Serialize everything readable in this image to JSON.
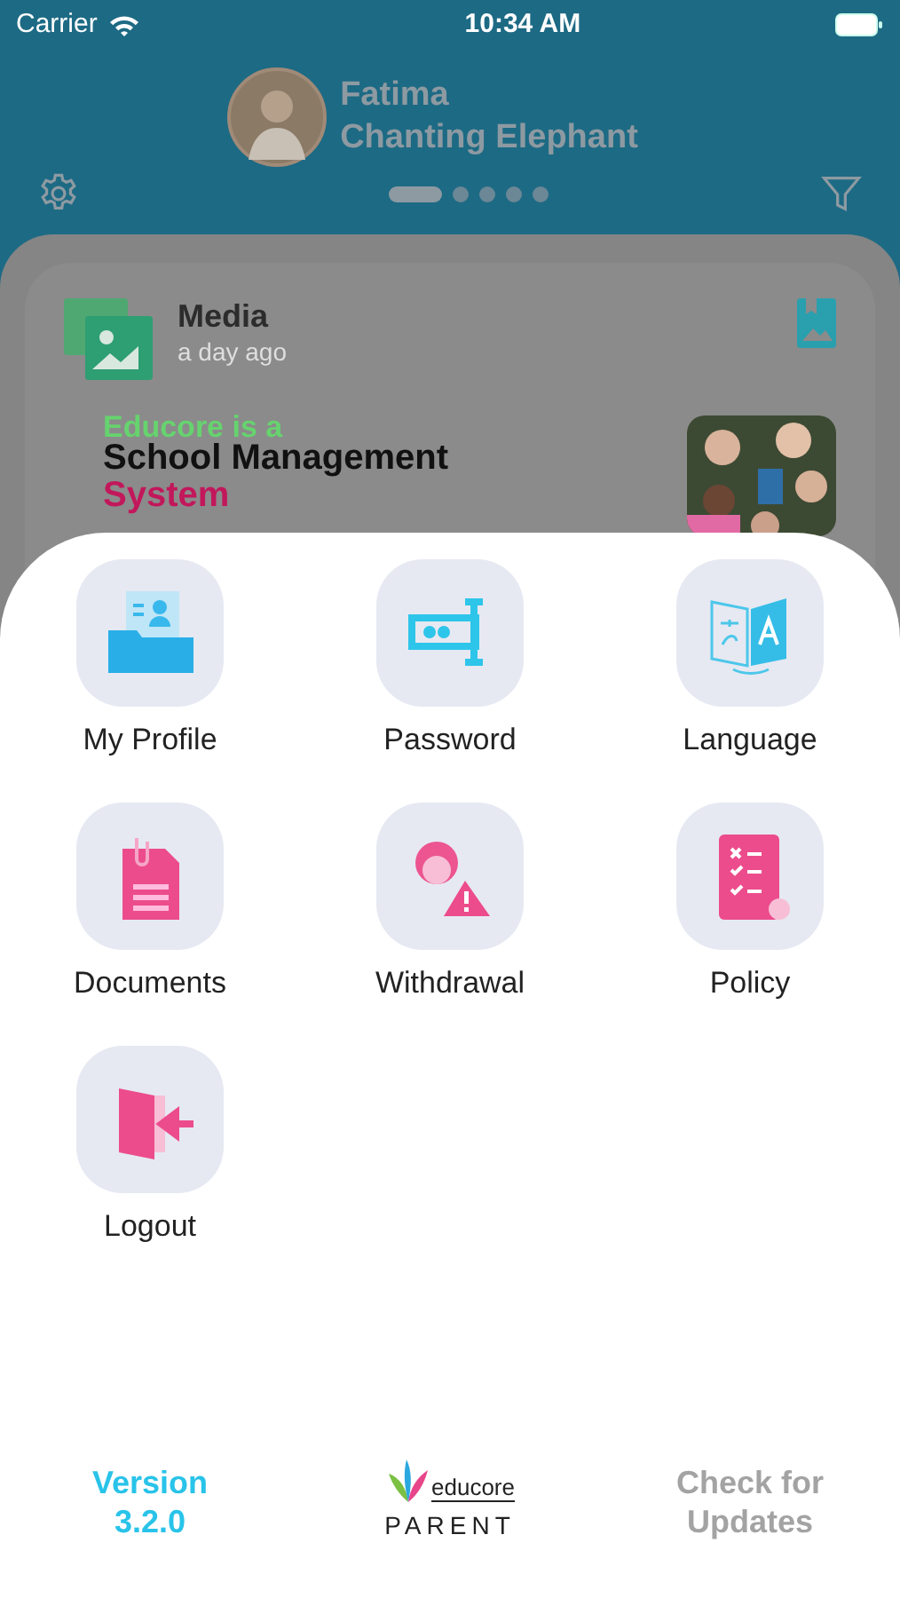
{
  "status_bar": {
    "carrier": "Carrier",
    "time": "10:34 AM"
  },
  "profile": {
    "name": "Fatima",
    "subtitle": "Chanting Elephant"
  },
  "pager_dots": [
    {
      "selected": true
    },
    {
      "selected": false
    },
    {
      "selected": false
    },
    {
      "selected": false
    },
    {
      "selected": false
    }
  ],
  "feed_card": {
    "title": "Media",
    "time": "a day ago",
    "banner_lines": [
      {
        "text": "Educore is a",
        "color": "#66d36e"
      },
      {
        "text": "School Management",
        "color": "#111111"
      },
      {
        "text": "System",
        "color": "#c2185b"
      }
    ]
  },
  "menu_items": [
    {
      "label": "My Profile",
      "kind": "profile"
    },
    {
      "label": "Password",
      "kind": "password"
    },
    {
      "label": "Language",
      "kind": "language"
    },
    {
      "label": "Documents",
      "kind": "documents"
    },
    {
      "label": "Withdrawal",
      "kind": "withdrawal"
    },
    {
      "label": "Policy",
      "kind": "policy"
    },
    {
      "label": "Logout",
      "kind": "logout"
    }
  ],
  "footer": {
    "version_label": "Version",
    "version": "3.2.0",
    "logo_text": "educore",
    "app_label": "PARENT",
    "update_button": {
      "label": "Check for Updates",
      "disabled": true
    }
  }
}
